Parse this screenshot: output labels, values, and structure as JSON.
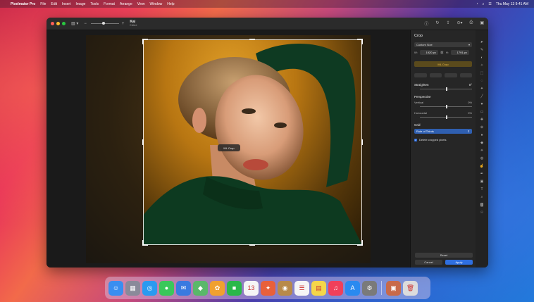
{
  "menubar": {
    "apple": "",
    "app_name": "Pixelmator Pro",
    "menus": [
      "File",
      "Edit",
      "Insert",
      "Image",
      "Tools",
      "Format",
      "Arrange",
      "View",
      "Window",
      "Help"
    ],
    "datetime": "Thu May 13  9:41 AM"
  },
  "document": {
    "title": "Kai",
    "subtitle": "Edited"
  },
  "canvas": {
    "ml_label": "ML Crop"
  },
  "crop_panel": {
    "title": "Crop",
    "preset": "Custom Size",
    "width_label": "W:",
    "width_value": "1920 px",
    "height_label": "H:",
    "height_value": "1791 px",
    "ml_crop_button": "ML Crop",
    "straighten_label": "Straighten",
    "straighten_value": "0°",
    "perspective_label": "Perspective",
    "vertical_label": "Vertical",
    "vertical_value": "0%",
    "horizontal_label": "Horizontal",
    "horizontal_value": "0%",
    "grid_label": "Grid",
    "grid_value": "Rule of Thirds",
    "delete_cropped_label": "Delete cropped pixels",
    "delete_cropped_checked": true,
    "reset_label": "Reset",
    "cancel_label": "Cancel",
    "apply_label": "Apply"
  },
  "dock": {
    "apps": [
      {
        "icon": "finder-icon",
        "color": "#3a8ef0",
        "glyph": "☺"
      },
      {
        "icon": "launchpad-icon",
        "color": "#8a8a9a",
        "glyph": "▦"
      },
      {
        "icon": "safari-icon",
        "color": "#2a9af0",
        "glyph": "◎"
      },
      {
        "icon": "messages-icon",
        "color": "#3ac85a",
        "glyph": "●"
      },
      {
        "icon": "mail-icon",
        "color": "#3a7ae0",
        "glyph": "✉"
      },
      {
        "icon": "maps-icon",
        "color": "#5ab86a",
        "glyph": "◆"
      },
      {
        "icon": "photos-icon",
        "color": "#f0a030",
        "glyph": "✿"
      },
      {
        "icon": "facetime-icon",
        "color": "#2ab84a",
        "glyph": "■"
      },
      {
        "icon": "calendar-icon",
        "color": "#f5f5f5",
        "glyph": "13"
      },
      {
        "icon": "pixelmator-icon",
        "color": "#e8603a",
        "glyph": "✦"
      },
      {
        "icon": "contacts-icon",
        "color": "#b88a4a",
        "glyph": "◉"
      },
      {
        "icon": "reminders-icon",
        "color": "#f5f5f5",
        "glyph": "☰"
      },
      {
        "icon": "notes-icon",
        "color": "#f5d64a",
        "glyph": "▤"
      },
      {
        "icon": "music-icon",
        "color": "#f0405a",
        "glyph": "♫"
      },
      {
        "icon": "app-store-icon",
        "color": "#2a8af0",
        "glyph": "A"
      },
      {
        "icon": "system-preferences-icon",
        "color": "#7a7a7a",
        "glyph": "⚙"
      }
    ],
    "extras": [
      {
        "icon": "photo-folder-icon",
        "color": "#c86a4a",
        "glyph": "▣"
      },
      {
        "icon": "trash-icon",
        "color": "#dcdcdc",
        "glyph": "🗑"
      }
    ]
  },
  "colors": {
    "accent": "#2f6fe0",
    "ml_gold": "#f2c14a",
    "panel": "#262626"
  }
}
